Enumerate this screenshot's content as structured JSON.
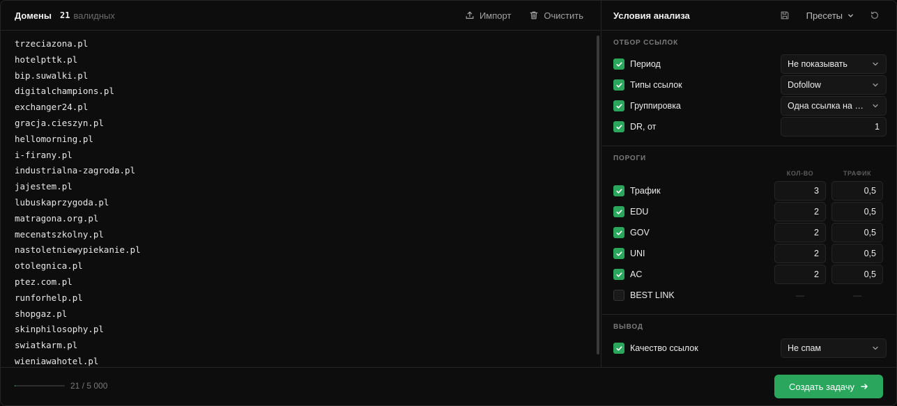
{
  "domains_panel": {
    "title": "Домены",
    "valid_count": "21",
    "valid_label": "валидных",
    "import_label": "Импорт",
    "clear_label": "Очистить",
    "domains": [
      "trzeciazona.pl",
      "hotelpttk.pl",
      "bip.suwalki.pl",
      "digitalchampions.pl",
      "exchanger24.pl",
      "gracja.cieszyn.pl",
      "hellomorning.pl",
      "i-firany.pl",
      "industrialna-zagroda.pl",
      "jajestem.pl",
      "lubuskaprzygoda.pl",
      "matragona.org.pl",
      "mecenatszkolny.pl",
      "nastoletniewypiekanie.pl",
      "otolegnica.pl",
      "ptez.com.pl",
      "runforhelp.pl",
      "shopgaz.pl",
      "skinphilosophy.pl",
      "swiatkarm.pl",
      "wieniawahotel.pl"
    ]
  },
  "footer": {
    "progress_text": "21 / 5 000",
    "progress_fraction": 0.0042,
    "create_button": "Создать задачу",
    "accent_color": "#2ba65d"
  },
  "conditions": {
    "title": "Условия анализа",
    "presets_label": "Пресеты",
    "link_selection": {
      "title": "ОТБОР ССЫЛОК",
      "period": {
        "label": "Период",
        "checked": true,
        "value": "Не показывать"
      },
      "link_types": {
        "label": "Типы ссылок",
        "checked": true,
        "value": "Dofollow"
      },
      "grouping": {
        "label": "Группировка",
        "checked": true,
        "value": "Одна ссылка на домен"
      },
      "dr_from": {
        "label": "DR, от",
        "checked": true,
        "value": "1"
      }
    },
    "thresholds": {
      "title": "ПОРОГИ",
      "col_count": "КОЛ-ВО",
      "col_traffic": "ТРАФИК",
      "rows": [
        {
          "label": "Трафик",
          "checked": true,
          "count": "3",
          "traffic": "0,5"
        },
        {
          "label": "EDU",
          "checked": true,
          "count": "2",
          "traffic": "0,5"
        },
        {
          "label": "GOV",
          "checked": true,
          "count": "2",
          "traffic": "0,5"
        },
        {
          "label": "UNI",
          "checked": true,
          "count": "2",
          "traffic": "0,5"
        },
        {
          "label": "AC",
          "checked": true,
          "count": "2",
          "traffic": "0,5"
        }
      ],
      "best_link": {
        "label": "BEST LINK",
        "checked": false,
        "count": "—",
        "traffic": "—"
      }
    },
    "output": {
      "title": "ВЫВОД",
      "quality": {
        "label": "Качество ссылок",
        "checked": true,
        "value": "Не спам"
      }
    }
  }
}
